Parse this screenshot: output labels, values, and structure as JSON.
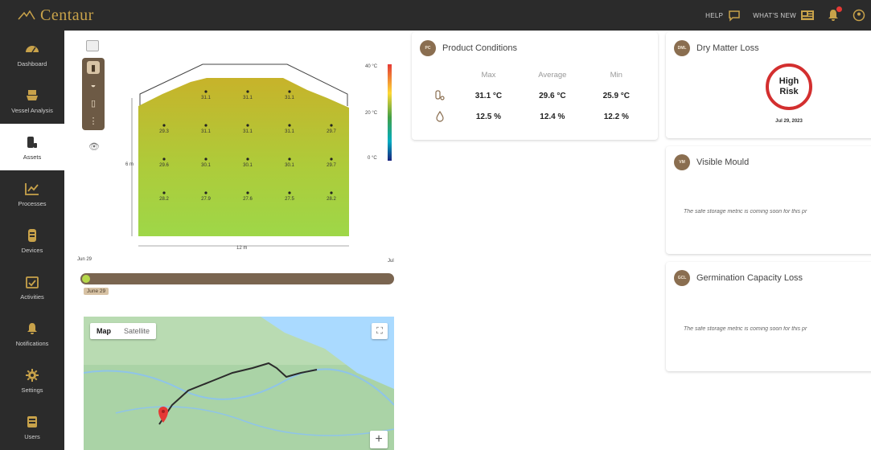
{
  "brand": {
    "name": "Centaur"
  },
  "topbar": {
    "help_label": "HELP",
    "whats_new_label": "WHAT'S NEW",
    "icons": [
      "chat-icon",
      "news-icon",
      "bell-icon",
      "user-icon"
    ]
  },
  "sidebar": {
    "items": [
      {
        "label": "Dashboard",
        "icon": "gauge-icon"
      },
      {
        "label": "Vessel Analysis",
        "icon": "ship-icon"
      },
      {
        "label": "Assets",
        "icon": "bag-icon",
        "active": true
      },
      {
        "label": "Processes",
        "icon": "chart-icon"
      },
      {
        "label": "Devices",
        "icon": "device-icon"
      },
      {
        "label": "Activities",
        "icon": "calendar-check-icon"
      },
      {
        "label": "Notifications",
        "icon": "bell-icon"
      },
      {
        "label": "Settings",
        "icon": "gear-icon"
      },
      {
        "label": "Users",
        "icon": "id-card-icon"
      }
    ]
  },
  "heatmap": {
    "scale_labels": {
      "max": "40 °C",
      "mid": "20 °C",
      "min": "0 °C"
    },
    "height_label": "6 m",
    "width_label": "12 m",
    "left_date": "Jun 29",
    "right_label": "Jul",
    "rows": [
      [
        "31.1",
        "31.1",
        "31.1"
      ],
      [
        "29.3",
        "31.1",
        "31.1",
        "31.1",
        "29.7"
      ],
      [
        "29.6",
        "30.1",
        "30.1",
        "30.1",
        "29.7"
      ],
      [
        "28.2",
        "27.9",
        "27.6",
        "27.5",
        "28.2"
      ]
    ],
    "timeline_date": "June 29",
    "colors": {
      "hot": "#c9b52a",
      "warm": "#aac83a",
      "cool": "#9fd44a"
    }
  },
  "map": {
    "tab_map": "Map",
    "tab_satellite": "Satellite",
    "zoom_in": "+"
  },
  "product_conditions": {
    "title": "Product Conditions",
    "badge": "PC",
    "headers": [
      "Max",
      "Average",
      "Min"
    ],
    "rows": [
      {
        "icon": "thermometer-icon",
        "values": [
          "31.1 °C",
          "29.6 °C",
          "25.9 °C"
        ]
      },
      {
        "icon": "droplet-icon",
        "values": [
          "12.5 %",
          "12.4 %",
          "12.2 %"
        ]
      }
    ]
  },
  "dry_matter_loss": {
    "title": "Dry Matter Loss",
    "badge": "DML",
    "risk_line1": "High",
    "risk_line2": "Risk",
    "date": "Jul 29, 2023",
    "risk_color": "#d32f2f"
  },
  "visible_mould": {
    "title": "Visible Mould",
    "badge": "VM",
    "message": "The safe storage metric is coming soon for this pr"
  },
  "germination": {
    "title": "Germination Capacity Loss",
    "badge": "GCL",
    "message": "The safe storage metric is coming soon for this pr"
  }
}
